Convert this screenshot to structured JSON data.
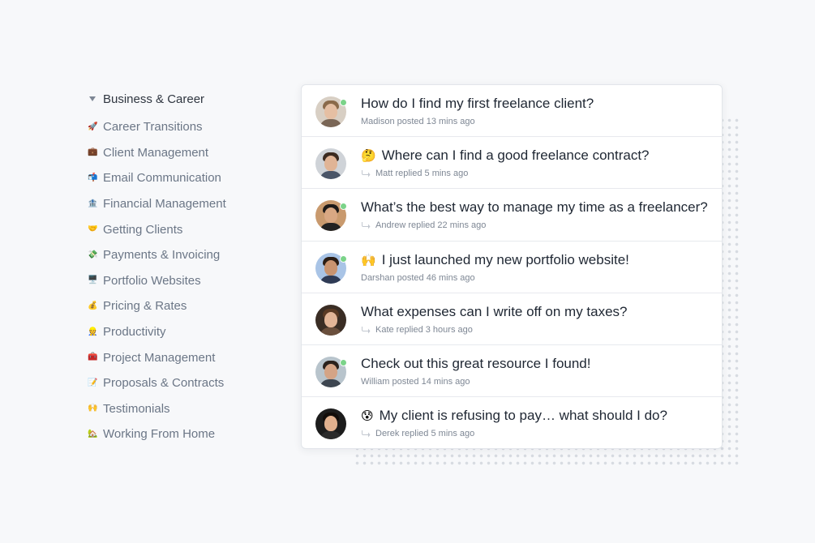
{
  "sidebar": {
    "category": "Business & Career",
    "items": [
      {
        "emoji": "🚀",
        "label": "Career Transitions"
      },
      {
        "emoji": "💼",
        "label": "Client Management"
      },
      {
        "emoji": "📬",
        "label": "Email Communication"
      },
      {
        "emoji": "🏦",
        "label": "Financial Management"
      },
      {
        "emoji": "🤝",
        "label": "Getting Clients"
      },
      {
        "emoji": "💸",
        "label": "Payments & Invoicing"
      },
      {
        "emoji": "🖥️",
        "label": "Portfolio Websites"
      },
      {
        "emoji": "💰",
        "label": "Pricing & Rates"
      },
      {
        "emoji": "👷",
        "label": "Productivity"
      },
      {
        "emoji": "🧰",
        "label": "Project Management"
      },
      {
        "emoji": "📝",
        "label": "Proposals & Contracts"
      },
      {
        "emoji": "🙌",
        "label": "Testimonials"
      },
      {
        "emoji": "🏡",
        "label": "Working From Home"
      }
    ]
  },
  "threads": [
    {
      "emoji": "",
      "title": "How do I find my first freelance client?",
      "meta": "Madison posted 13 mins ago",
      "replied": false,
      "online": true
    },
    {
      "emoji": "🤔",
      "title": "Where can I find a good freelance contract?",
      "meta": "Matt replied 5 mins ago",
      "replied": true,
      "online": false
    },
    {
      "emoji": "",
      "title": "What’s the best way to manage my time as a freelancer?",
      "meta": "Andrew replied 22 mins ago",
      "replied": true,
      "online": true
    },
    {
      "emoji": "🙌",
      "title": "I just launched my new portfolio website!",
      "meta": "Darshan posted 46 mins ago",
      "replied": false,
      "online": true
    },
    {
      "emoji": "",
      "title": "What expenses can I write off on my taxes?",
      "meta": "Kate replied 3 hours ago",
      "replied": true,
      "online": false
    },
    {
      "emoji": "",
      "title": "Check out this great resource I found!",
      "meta": "William posted 14 mins ago",
      "replied": false,
      "online": true
    },
    {
      "emoji": "😰",
      "title": "My client is refusing to pay… what should I do?",
      "meta": "Derek replied 5 mins ago",
      "replied": true,
      "online": false
    }
  ],
  "colors": {
    "online": "#7bd389",
    "title_text": "#1f2733",
    "meta_text": "#7e8794",
    "sidebar_text": "#6b7686"
  }
}
